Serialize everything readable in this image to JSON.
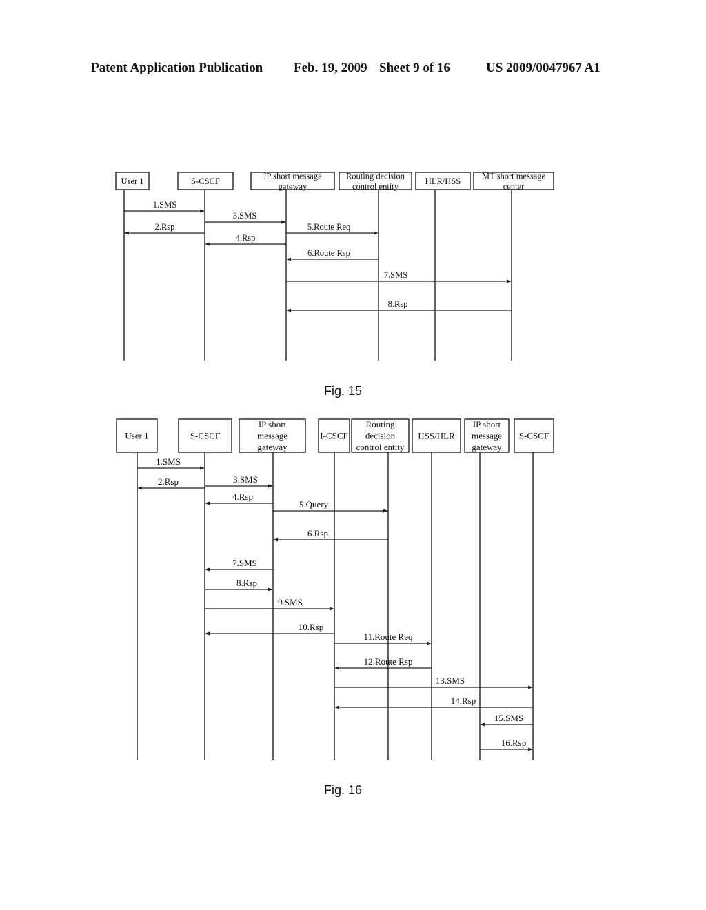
{
  "header": {
    "publication": "Patent Application Publication",
    "date": "Feb. 19, 2009",
    "sheet": "Sheet 9 of 16",
    "number": "US 2009/0047967 A1"
  },
  "figures": [
    {
      "id": "fig15",
      "caption": "Fig. 15",
      "entities": [
        {
          "id": "u1",
          "lines": [
            "User 1"
          ]
        },
        {
          "id": "scscf",
          "lines": [
            "S-CSCF"
          ]
        },
        {
          "id": "ipsmg",
          "lines": [
            "IP short message",
            "gateway"
          ]
        },
        {
          "id": "rdce",
          "lines": [
            "Routing decision",
            "control entity"
          ]
        },
        {
          "id": "hlr",
          "lines": [
            "HLR/HSS"
          ]
        },
        {
          "id": "mtsmc",
          "lines": [
            "MT short message",
            "center"
          ]
        }
      ],
      "messages": [
        {
          "label": "1.SMS",
          "from": "u1",
          "to": "scscf"
        },
        {
          "label": "2.Rsp",
          "from": "scscf",
          "to": "u1"
        },
        {
          "label": "3.SMS",
          "from": "scscf",
          "to": "ipsmg"
        },
        {
          "label": "4.Rsp",
          "from": "ipsmg",
          "to": "scscf"
        },
        {
          "label": "5.Route Req",
          "from": "ipsmg",
          "to": "rdce"
        },
        {
          "label": "6.Route Rsp",
          "from": "rdce",
          "to": "ipsmg"
        },
        {
          "label": "7.SMS",
          "from": "ipsmg",
          "to": "mtsmc"
        },
        {
          "label": "8.Rsp",
          "from": "mtsmc",
          "to": "ipsmg"
        }
      ]
    },
    {
      "id": "fig16",
      "caption": "Fig. 16",
      "entities": [
        {
          "id": "u1",
          "lines": [
            "User 1"
          ]
        },
        {
          "id": "scscf1",
          "lines": [
            "S-CSCF"
          ]
        },
        {
          "id": "ipsmg1",
          "lines": [
            "IP short",
            "message",
            "gateway"
          ]
        },
        {
          "id": "icscf",
          "lines": [
            "I-CSCF"
          ]
        },
        {
          "id": "rdce",
          "lines": [
            "Routing",
            "decision",
            "control entity"
          ]
        },
        {
          "id": "hss",
          "lines": [
            "HSS/HLR"
          ]
        },
        {
          "id": "ipsmg2",
          "lines": [
            "IP short",
            "message",
            "gateway"
          ]
        },
        {
          "id": "scscf2",
          "lines": [
            "S-CSCF"
          ]
        }
      ],
      "messages": [
        {
          "label": "1.SMS",
          "from": "u1",
          "to": "scscf1"
        },
        {
          "label": "2.Rsp",
          "from": "scscf1",
          "to": "u1"
        },
        {
          "label": "3.SMS",
          "from": "scscf1",
          "to": "ipsmg1"
        },
        {
          "label": "4.Rsp",
          "from": "ipsmg1",
          "to": "scscf1"
        },
        {
          "label": "5.Query",
          "from": "ipsmg1",
          "to": "rdce"
        },
        {
          "label": "6.Rsp",
          "from": "rdce",
          "to": "ipsmg1"
        },
        {
          "label": "7.SMS",
          "from": "ipsmg1",
          "to": "scscf1"
        },
        {
          "label": "8.Rsp",
          "from": "scscf1",
          "to": "ipsmg1"
        },
        {
          "label": "9.SMS",
          "from": "scscf1",
          "to": "icscf"
        },
        {
          "label": "10.Rsp",
          "from": "icscf",
          "to": "scscf1"
        },
        {
          "label": "11.Route Req",
          "from": "icscf",
          "to": "hss"
        },
        {
          "label": "12.Route Rsp",
          "from": "hss",
          "to": "icscf"
        },
        {
          "label": "13.SMS",
          "from": "icscf",
          "to": "scscf2"
        },
        {
          "label": "14.Rsp",
          "from": "scscf2",
          "to": "icscf"
        },
        {
          "label": "15.SMS",
          "from": "scscf2",
          "to": "ipsmg2"
        },
        {
          "label": "16.Rsp",
          "from": "ipsmg2",
          "to": "scscf2"
        }
      ]
    }
  ]
}
